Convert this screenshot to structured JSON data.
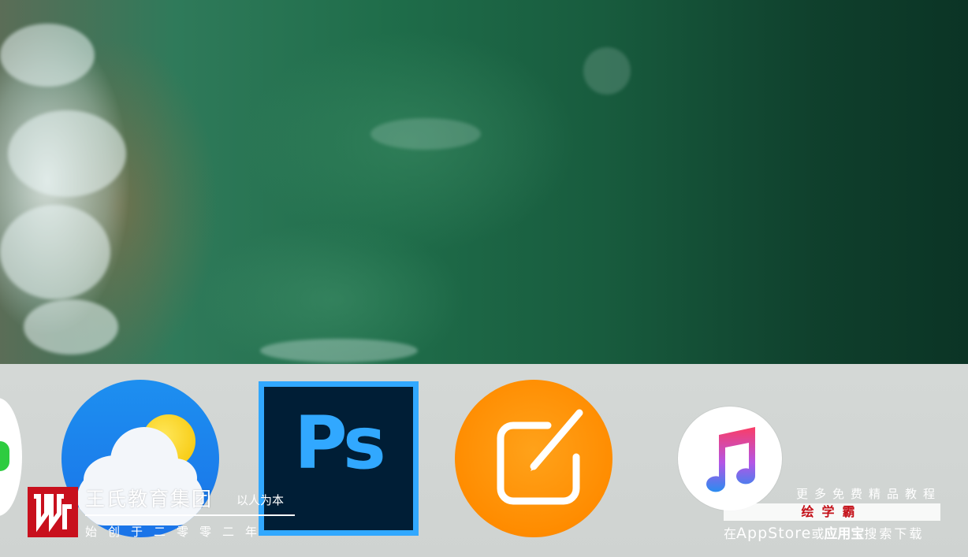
{
  "dock": {
    "apps": [
      {
        "id": "partial-app",
        "icon": "partial-app-icon"
      },
      {
        "id": "weather",
        "icon": "weather-icon",
        "colors": {
          "background": "#1a73e8",
          "sun": "#f5c400",
          "cloud": "#f3f6fa"
        }
      },
      {
        "id": "photoshop",
        "icon": "photoshop-icon",
        "label": "Ps",
        "colors": {
          "background": "#001e36",
          "accent": "#31a8ff"
        }
      },
      {
        "id": "notes",
        "icon": "compose-icon",
        "colors": {
          "background": "#ff8c00"
        }
      },
      {
        "id": "music",
        "icon": "music-note-icon",
        "colors": {
          "background": "#ffffff"
        }
      }
    ]
  },
  "watermark": {
    "logo": "brand-w-logo",
    "title": "王氏教育集团",
    "tagline": "以人为本",
    "since": "始创于二零零二年",
    "brand_color": "#c8101d"
  },
  "promo": {
    "top": "更多免费精品教程",
    "badge": "绘学霸",
    "bottom_prefix": "在",
    "bottom_store1": "AppStore",
    "bottom_or": "或",
    "bottom_store2": "应用宝",
    "bottom_suffix": "搜索下载",
    "badge_color": "#c41018"
  }
}
